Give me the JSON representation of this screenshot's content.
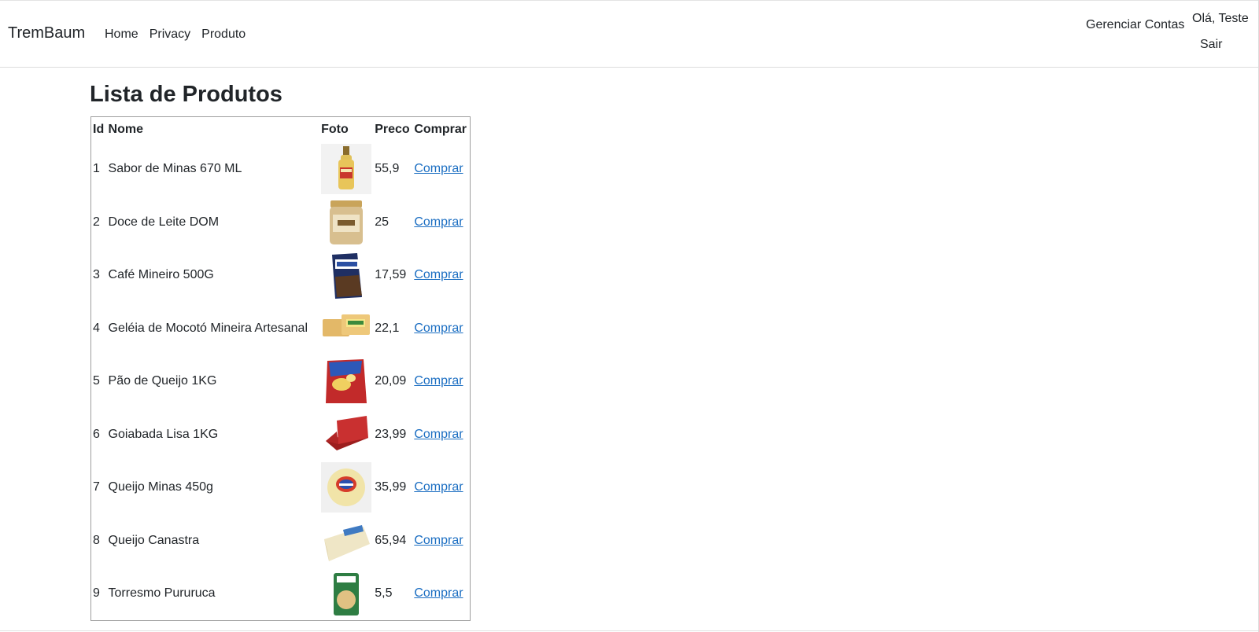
{
  "navbar": {
    "brand": "TremBaum",
    "links": [
      {
        "label": "Home"
      },
      {
        "label": "Privacy"
      },
      {
        "label": "Produto"
      }
    ],
    "manage_accounts": "Gerenciar Contas",
    "greeting": "Olá, Teste",
    "logout": "Sair"
  },
  "main": {
    "title": "Lista de Produtos",
    "table": {
      "headers": {
        "id": "Id",
        "name": "Nome",
        "photo": "Foto",
        "price": "Preco",
        "buy": "Comprar"
      },
      "rows": [
        {
          "id": "1",
          "name": "Sabor de Minas 670 ML",
          "price": "55,9",
          "buy": "Comprar",
          "photo_icon": "liquor-bottle-icon"
        },
        {
          "id": "2",
          "name": "Doce de Leite DOM",
          "price": "25",
          "buy": "Comprar",
          "photo_icon": "jar-icon"
        },
        {
          "id": "3",
          "name": "Café Mineiro 500G",
          "price": "17,59",
          "buy": "Comprar",
          "photo_icon": "coffee-bag-icon"
        },
        {
          "id": "4",
          "name": "Geléia de Mocotó Mineira Artesanal",
          "price": "22,1",
          "buy": "Comprar",
          "photo_icon": "jelly-package-icon"
        },
        {
          "id": "5",
          "name": "Pão de Queijo 1KG",
          "price": "20,09",
          "buy": "Comprar",
          "photo_icon": "bread-bag-icon"
        },
        {
          "id": "6",
          "name": "Goiabada Lisa 1KG",
          "price": "23,99",
          "buy": "Comprar",
          "photo_icon": "guava-paste-icon"
        },
        {
          "id": "7",
          "name": "Queijo Minas 450g",
          "price": "35,99",
          "buy": "Comprar",
          "photo_icon": "round-cheese-icon"
        },
        {
          "id": "8",
          "name": "Queijo Canastra",
          "price": "65,94",
          "buy": "Comprar",
          "photo_icon": "cheese-wheel-icon"
        },
        {
          "id": "9",
          "name": "Torresmo Pururuca",
          "price": "5,5",
          "buy": "Comprar",
          "photo_icon": "snack-bag-icon"
        }
      ]
    }
  },
  "colors": {
    "text": "#212529",
    "link": "#1b6ec2",
    "table_border": "#9e9e9e"
  }
}
